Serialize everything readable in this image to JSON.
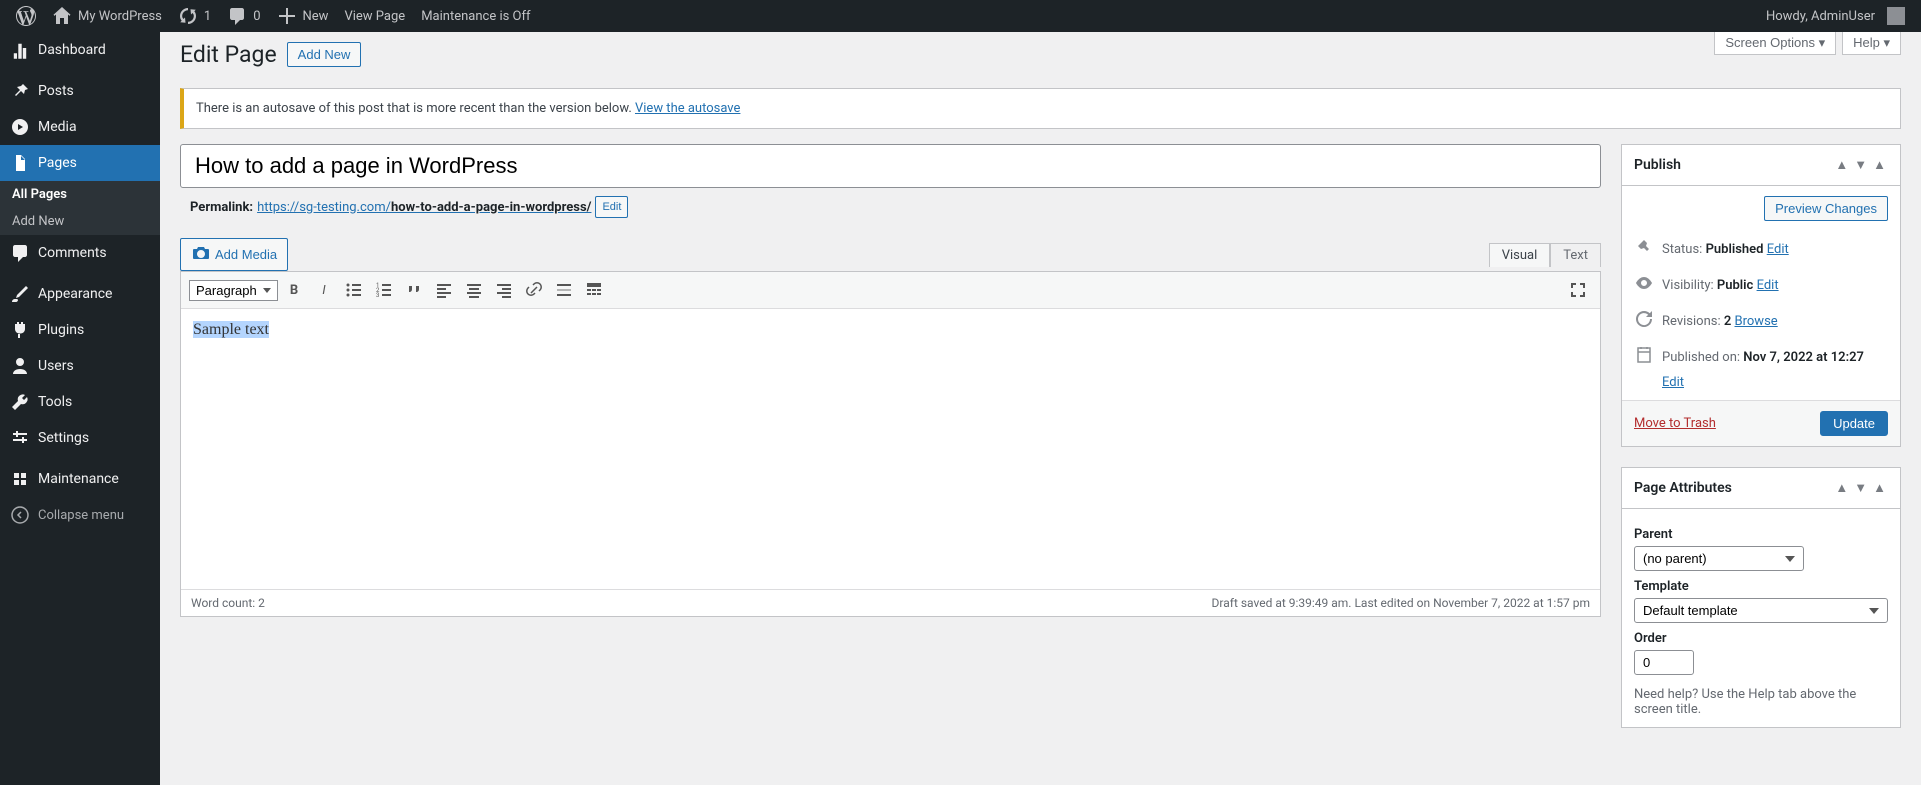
{
  "adminbar": {
    "site_name": "My WordPress",
    "updates_count": "1",
    "comments_count": "0",
    "new_label": "New",
    "view_page": "View Page",
    "maintenance": "Maintenance is Off",
    "howdy": "Howdy, AdminUser"
  },
  "sidebar": {
    "items": [
      {
        "label": "Dashboard"
      },
      {
        "label": "Posts"
      },
      {
        "label": "Media"
      },
      {
        "label": "Pages"
      },
      {
        "label": "Comments"
      },
      {
        "label": "Appearance"
      },
      {
        "label": "Plugins"
      },
      {
        "label": "Users"
      },
      {
        "label": "Tools"
      },
      {
        "label": "Settings"
      },
      {
        "label": "Maintenance"
      },
      {
        "label": "Collapse menu"
      }
    ],
    "sub_pages": {
      "all": "All Pages",
      "add": "Add New"
    }
  },
  "screen_meta": {
    "options": "Screen Options",
    "help": "Help"
  },
  "heading": {
    "title": "Edit Page",
    "add_new": "Add New"
  },
  "notice": {
    "text": "There is an autosave of this post that is more recent than the version below. ",
    "link": "View the autosave"
  },
  "title_value": "How to add a page in WordPress",
  "permalink": {
    "label": "Permalink:",
    "base": "https://sg-testing.com/",
    "slug": "how-to-add-a-page-in-wordpress/",
    "edit": "Edit"
  },
  "editor": {
    "add_media": "Add Media",
    "tab_visual": "Visual",
    "tab_text": "Text",
    "format": "Paragraph",
    "content": "Sample text",
    "word_count": "Word count: 2",
    "footer_status": "Draft saved at 9:39:49 am. Last edited on November 7, 2022 at 1:57 pm"
  },
  "publish": {
    "title": "Publish",
    "preview": "Preview Changes",
    "status_label": "Status:",
    "status_value": "Published",
    "status_edit": "Edit",
    "visibility_label": "Visibility:",
    "visibility_value": "Public",
    "visibility_edit": "Edit",
    "revisions_label": "Revisions:",
    "revisions_value": "2",
    "revisions_browse": "Browse",
    "published_label": "Published on:",
    "published_value": "Nov 7, 2022 at 12:27",
    "published_edit": "Edit",
    "trash": "Move to Trash",
    "update": "Update"
  },
  "attributes": {
    "title": "Page Attributes",
    "parent_label": "Parent",
    "parent_value": "(no parent)",
    "template_label": "Template",
    "template_value": "Default template",
    "order_label": "Order",
    "order_value": "0",
    "help": "Need help? Use the Help tab above the screen title."
  }
}
